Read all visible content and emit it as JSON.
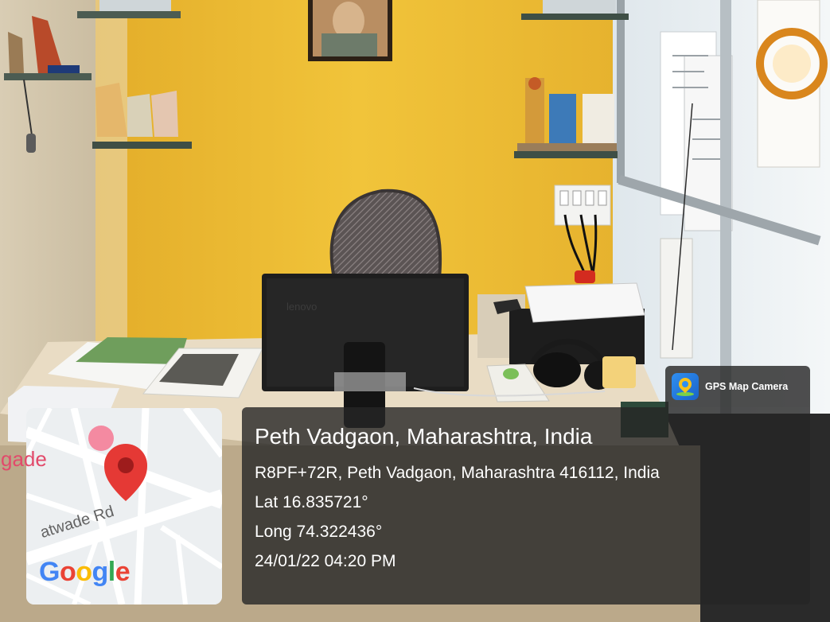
{
  "badge": {
    "label": "GPS Map Camera"
  },
  "location": {
    "title": "Peth Vadgaon, Maharashtra, India",
    "address": "R8PF+72R, Peth Vadgaon, Maharashtra 416112, India",
    "lat": "Lat 16.835721°",
    "long": "Long 74.322436°",
    "datetime": "24/01/22 04:20 PM"
  },
  "map": {
    "place_label": "gade",
    "road_label": "atwade Rd",
    "logo": [
      "G",
      "o",
      "o",
      "g",
      "l",
      "e"
    ],
    "colors": {
      "pin": "#e53935",
      "place": "#e24a6b",
      "road": "#646464"
    }
  },
  "photo": {
    "monitor_brand": "lenovo",
    "colors": {
      "wall": "#f0c233",
      "desk": "#e9dcc4",
      "monitor": "#1e1e1e"
    }
  }
}
